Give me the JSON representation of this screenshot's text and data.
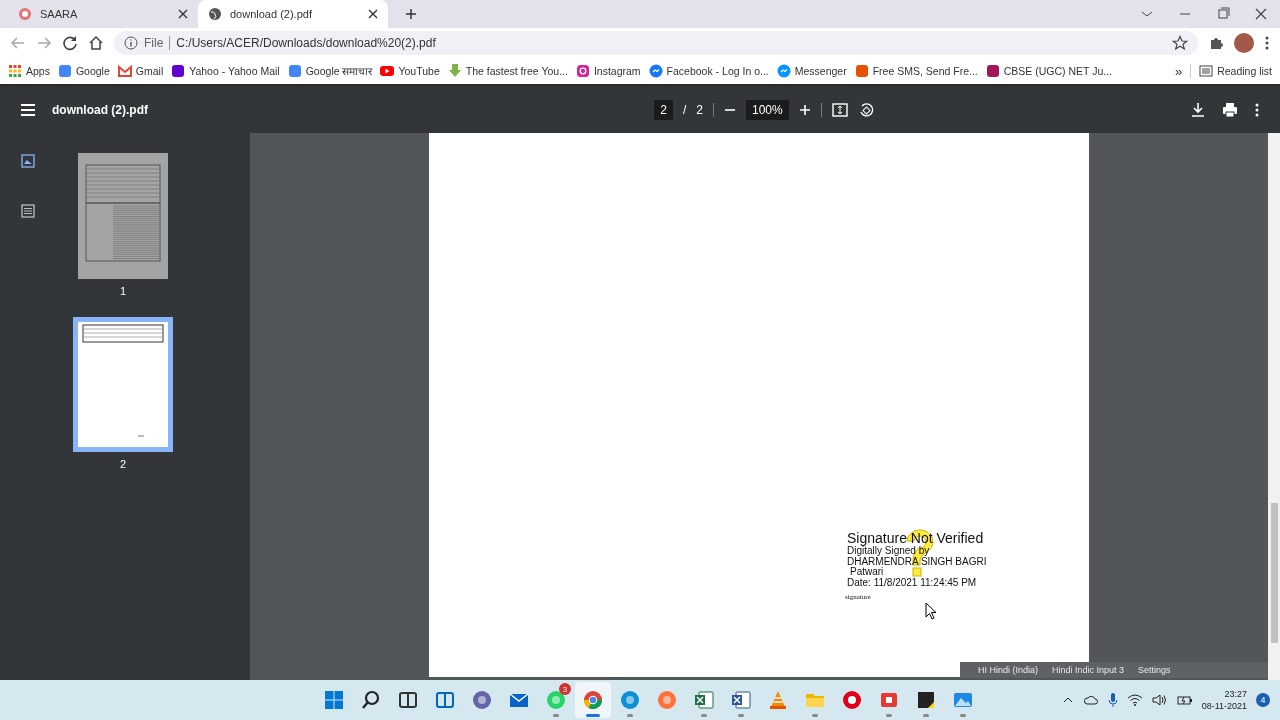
{
  "browser_tabs": [
    {
      "title": "SAARA",
      "kind": "site",
      "selected": false
    },
    {
      "title": "download (2).pdf",
      "kind": "globe",
      "selected": true
    }
  ],
  "address_bar": {
    "scheme_label": "File",
    "url": "C:/Users/ACER/Downloads/download%20(2).pdf"
  },
  "bookmarks": [
    {
      "label": "Apps",
      "kind": "apps"
    },
    {
      "label": "Google",
      "kind": "google"
    },
    {
      "label": "Gmail",
      "kind": "gmail"
    },
    {
      "label": "Yahoo - Yahoo Mail",
      "kind": "yahoo"
    },
    {
      "label": "Google समाचार",
      "kind": "news"
    },
    {
      "label": "YouTube",
      "kind": "youtube"
    },
    {
      "label": "The fastest free You...",
      "kind": "download"
    },
    {
      "label": "Instagram",
      "kind": "instagram"
    },
    {
      "label": "Facebook - Log In o...",
      "kind": "facebook"
    },
    {
      "label": "Messenger",
      "kind": "messenger"
    },
    {
      "label": "Free SMS, Send Fre...",
      "kind": "sms"
    },
    {
      "label": "CBSE (UGC) NET Ju...",
      "kind": "cbse"
    }
  ],
  "bookmark_overflow": "»",
  "reading_list": "Reading list",
  "pdf_toolbar": {
    "title": "download (2).pdf",
    "page": "2",
    "page_separator": "/",
    "page_count": "2",
    "zoom": "100%"
  },
  "sidebar_views": [
    {
      "kind": "thumbnails",
      "selected": true
    },
    {
      "kind": "outline",
      "selected": false
    }
  ],
  "thumbnails": [
    {
      "label": "1",
      "kind": "full",
      "selected": false
    },
    {
      "label": "2",
      "kind": "short",
      "selected": true
    }
  ],
  "signature": {
    "title": "Signature Not Verified",
    "lines": [
      "Digitally Signed by",
      "DHARMENDRA SINGH BAGRI",
      "Patwari",
      "Date: 11/8/2021 11:24:45 PM"
    ],
    "overlay_label": "signature"
  },
  "ime_bar": [
    "HI Hindi (India)",
    "Hindi Indic Input 3",
    "Settings"
  ],
  "taskbar": {
    "apps": [
      {
        "kind": "start",
        "running": false,
        "selected": false
      },
      {
        "kind": "search",
        "running": false,
        "selected": false
      },
      {
        "kind": "taskview",
        "running": false,
        "selected": false
      },
      {
        "kind": "widgets",
        "running": false,
        "selected": false
      },
      {
        "kind": "chat",
        "running": false,
        "selected": false
      },
      {
        "kind": "mail",
        "running": false,
        "selected": false
      },
      {
        "kind": "whatsapp",
        "running": true,
        "selected": false,
        "badge": "3"
      },
      {
        "kind": "chrome",
        "running": true,
        "selected": true
      },
      {
        "kind": "edge",
        "running": true,
        "selected": false
      },
      {
        "kind": "firefox",
        "running": false,
        "selected": false
      },
      {
        "kind": "excel",
        "running": true,
        "selected": false
      },
      {
        "kind": "word",
        "running": true,
        "selected": false
      },
      {
        "kind": "vlc",
        "running": false,
        "selected": false
      },
      {
        "kind": "explorer",
        "running": true,
        "selected": false
      },
      {
        "kind": "opera",
        "running": false,
        "selected": false
      },
      {
        "kind": "recorder",
        "running": true,
        "selected": false
      },
      {
        "kind": "sticky",
        "running": true,
        "selected": false
      },
      {
        "kind": "photos",
        "running": true,
        "selected": false
      }
    ],
    "time": "23:27",
    "date": "08-11-2021",
    "notifications": "4"
  }
}
